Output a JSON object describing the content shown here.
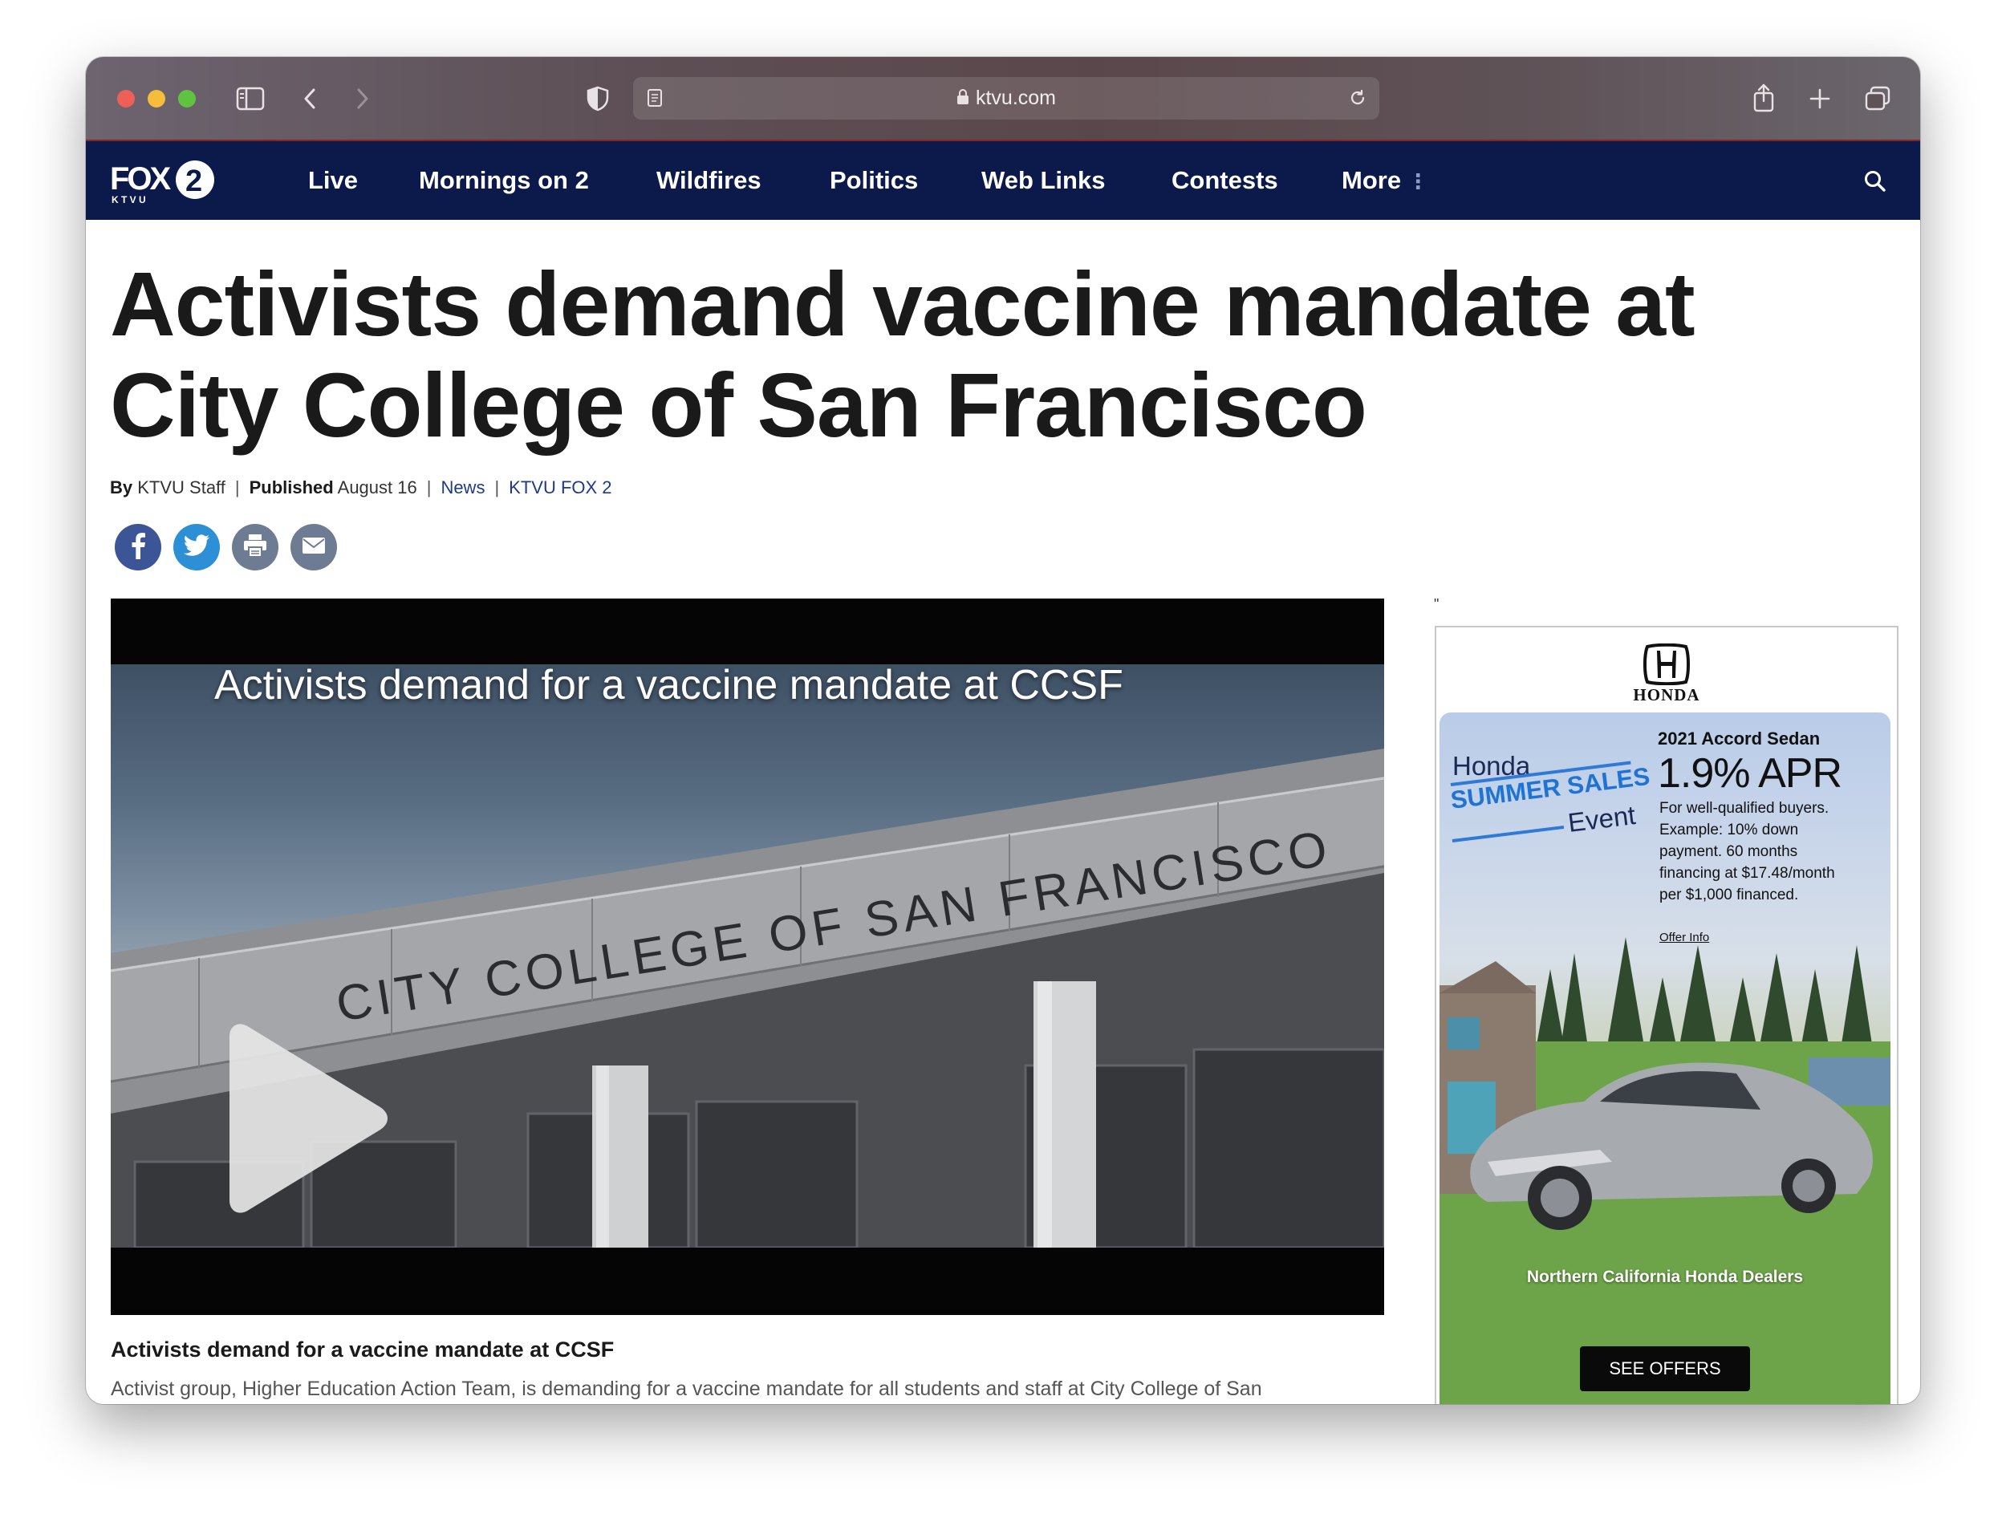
{
  "browser": {
    "url": "ktvu.com",
    "icons": [
      "sidebar-icon",
      "back-icon",
      "forward-icon",
      "shield-icon",
      "reader-icon",
      "lock-icon",
      "reload-icon",
      "share-icon",
      "new-tab-icon",
      "tabs-overview-icon"
    ]
  },
  "site": {
    "logo_text": "FOX",
    "logo_number": "2",
    "logo_sub": "K T V U",
    "nav": [
      {
        "label": "Live"
      },
      {
        "label": "Mornings on 2"
      },
      {
        "label": "Wildfires"
      },
      {
        "label": "Politics"
      },
      {
        "label": "Web Links"
      },
      {
        "label": "Contests"
      },
      {
        "label": "More"
      }
    ],
    "nav_bg": "#0b1a4a"
  },
  "article": {
    "headline_line1": "Activists demand vaccine mandate at",
    "headline_line2": "City College of San Francisco",
    "byline": {
      "by_label": "By",
      "author": "KTVU Staff",
      "published_label": "Published",
      "date": "August 16",
      "category": "News",
      "source": "KTVU FOX 2"
    },
    "share": [
      "facebook-icon",
      "twitter-icon",
      "print-icon",
      "email-icon"
    ],
    "video": {
      "title": "Activists demand for a vaccine mandate at CCSF",
      "building_sign": "CITY COLLEGE OF SAN FRANCISCO"
    },
    "caption_title": "Activists demand for a vaccine mandate at CCSF",
    "caption_text": "Activist group, Higher Education Action Team, is demanding for a vaccine mandate for all students and staff at City College of San"
  },
  "ad": {
    "quote_mark": "\"",
    "brand": "HONDA",
    "event_line1": "Honda",
    "event_line2": "SUMMER SALES",
    "event_line3": "Event",
    "model": "2021 Accord Sedan",
    "apr": "1.9% APR",
    "terms": [
      "For well-qualified buyers.",
      "Example: 10% down",
      "payment. 60 months",
      "financing at $17.48/month",
      "per $1,000 financed."
    ],
    "offer_info": "Offer Info",
    "dealers": "Northern California Honda Dealers",
    "cta": "SEE OFFERS"
  }
}
